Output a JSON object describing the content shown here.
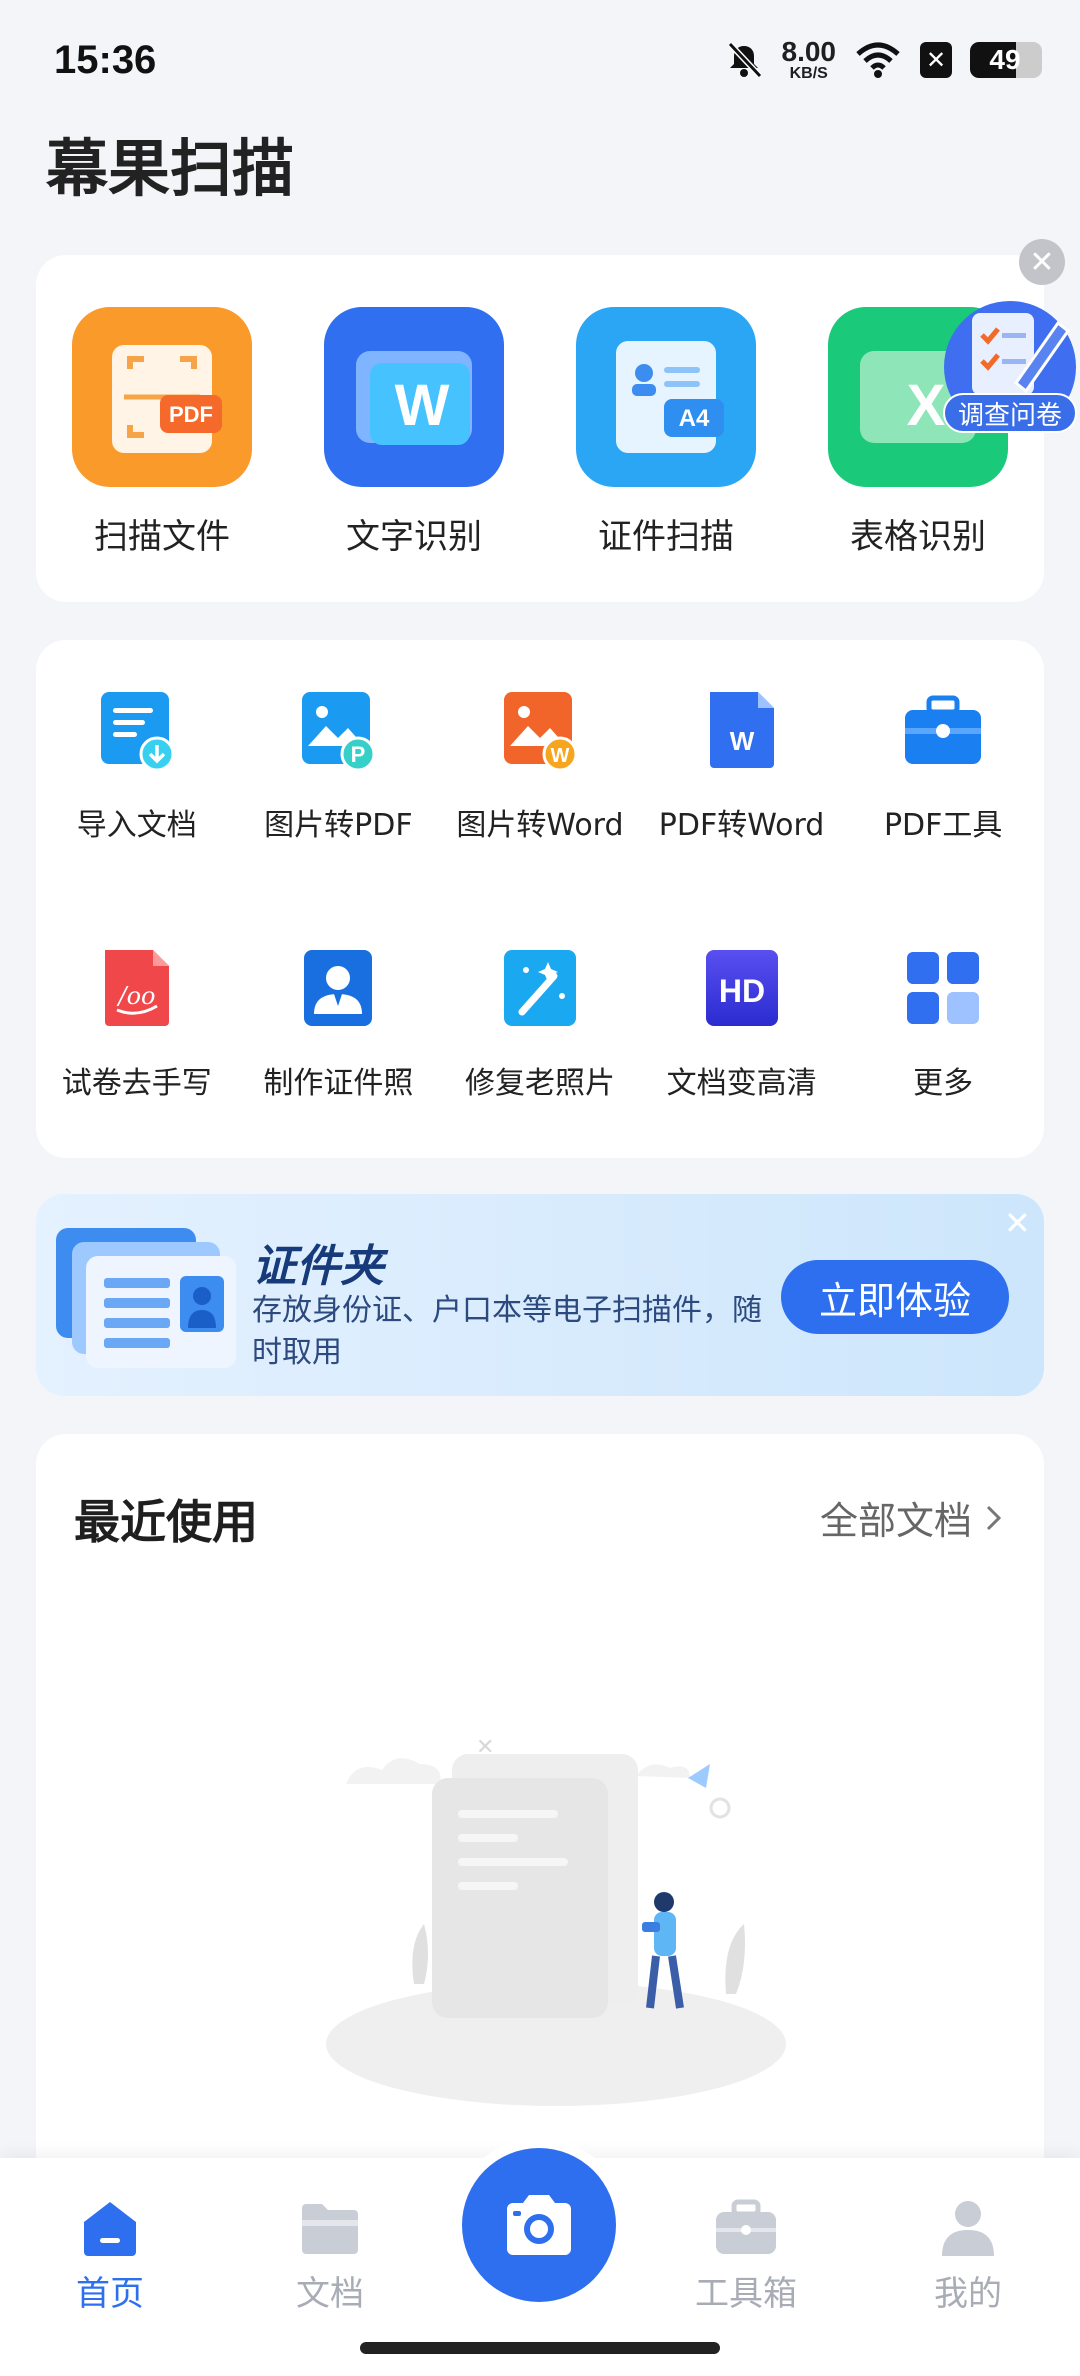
{
  "status": {
    "time": "15:36",
    "speed_value": "8.00",
    "speed_unit": "KB/S",
    "battery": "49"
  },
  "app": {
    "title": "幕果扫描"
  },
  "main_features": [
    {
      "label": "扫描文件",
      "icon": "scan-pdf-icon",
      "color": "#f99a2a"
    },
    {
      "label": "文字识别",
      "icon": "word-icon",
      "color": "#2f6ff0"
    },
    {
      "label": "证件扫描",
      "icon": "id-card-a4-icon",
      "color": "#2aa6f5"
    },
    {
      "label": "表格识别",
      "icon": "excel-icon",
      "color": "#1bc97a"
    }
  ],
  "survey": {
    "label": "调查问卷"
  },
  "tools_row1": [
    {
      "label": "导入文档",
      "icon": "import-doc-icon"
    },
    {
      "label": "图片转PDF",
      "icon": "image-to-pdf-icon"
    },
    {
      "label": "图片转Word",
      "icon": "image-to-word-icon"
    },
    {
      "label": "PDF转Word",
      "icon": "pdf-to-word-icon"
    },
    {
      "label": "PDF工具",
      "icon": "toolbox-icon"
    }
  ],
  "tools_row2": [
    {
      "label": "试卷去手写",
      "icon": "remove-handwriting-icon"
    },
    {
      "label": "制作证件照",
      "icon": "id-photo-icon"
    },
    {
      "label": "修复老照片",
      "icon": "magic-wand-icon"
    },
    {
      "label": "文档变高清",
      "icon": "hd-icon"
    },
    {
      "label": "更多",
      "icon": "grid-more-icon"
    }
  ],
  "banner": {
    "title": "证件夹",
    "desc": "存放身份证、户口本等电子扫描件，随时取用",
    "button": "立即体验"
  },
  "recent": {
    "title": "最近使用",
    "all_docs": "全部文档"
  },
  "nav": {
    "home": "首页",
    "docs": "文档",
    "toolbox": "工具箱",
    "mine": "我的"
  }
}
